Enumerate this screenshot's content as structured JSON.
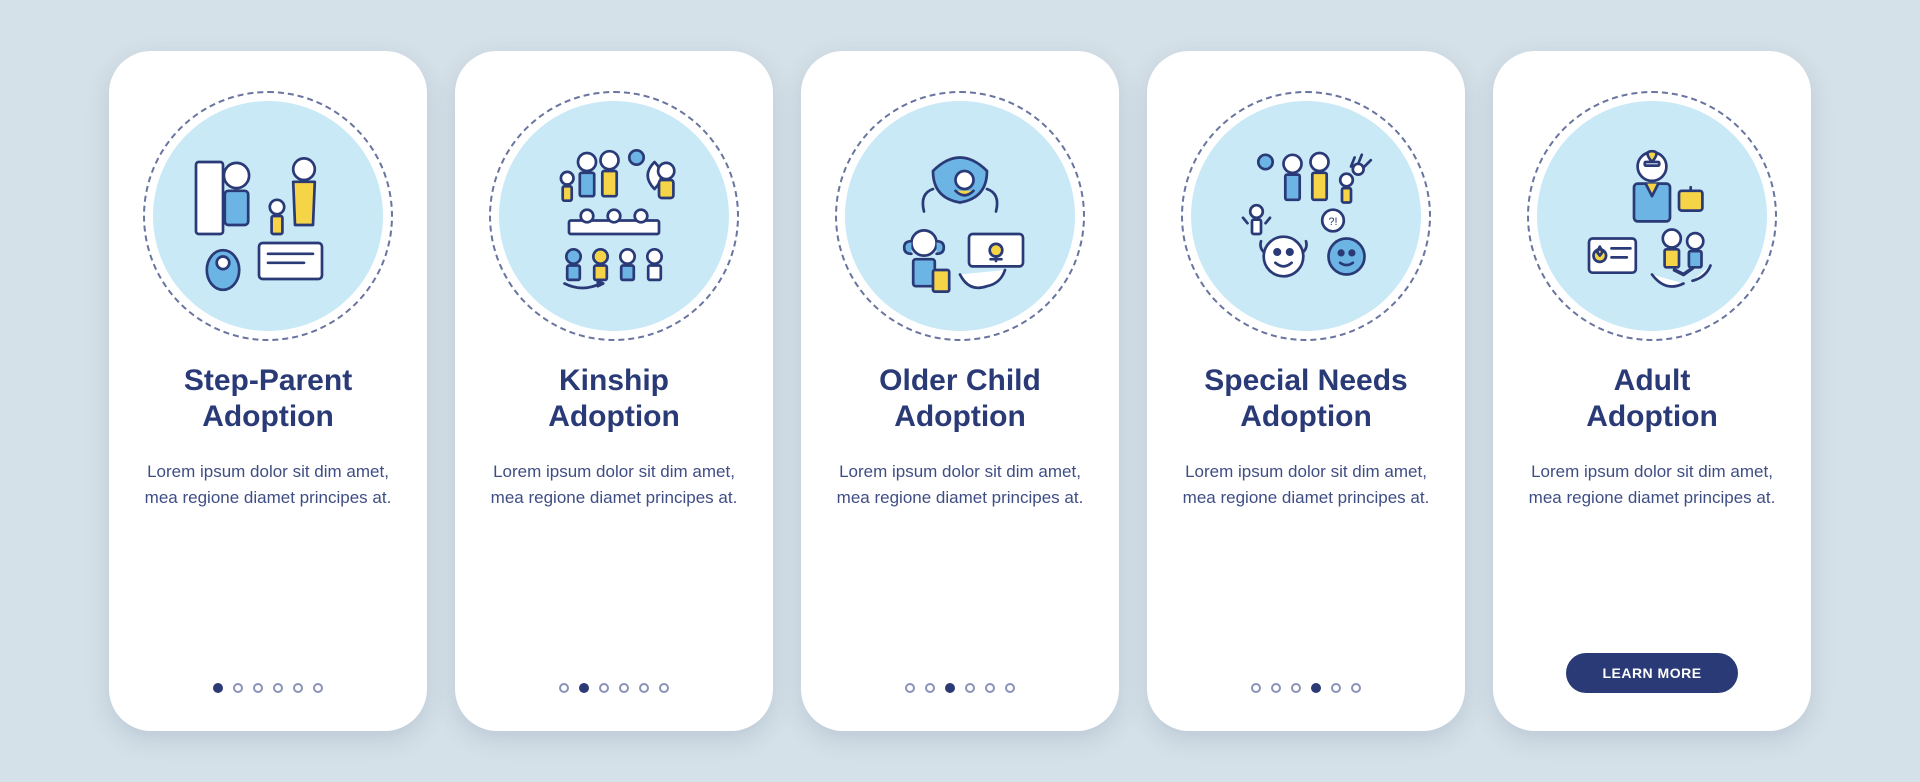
{
  "colors": {
    "background": "#d5e1e8",
    "card_bg": "#ffffff",
    "primary": "#2a3a77",
    "accent_light": "#c9e9f6",
    "accent_yellow": "#f5d547",
    "accent_blue": "#6cb4e4"
  },
  "total_pages": 6,
  "cards": [
    {
      "title": "Step-Parent\nAdoption",
      "description": "Lorem ipsum dolor sit dim amet, mea regione diamet principes at.",
      "active_dot": 0,
      "show_button": false,
      "icon_name": "step-parent-icon"
    },
    {
      "title": "Kinship\nAdoption",
      "description": "Lorem ipsum dolor sit dim amet, mea regione diamet principes at.",
      "active_dot": 1,
      "show_button": false,
      "icon_name": "kinship-icon"
    },
    {
      "title": "Older Child\nAdoption",
      "description": "Lorem ipsum dolor sit dim amet, mea regione diamet principes at.",
      "active_dot": 2,
      "show_button": false,
      "icon_name": "older-child-icon"
    },
    {
      "title": "Special Needs\nAdoption",
      "description": "Lorem ipsum dolor sit dim amet, mea regione diamet principes at.",
      "active_dot": 3,
      "show_button": false,
      "icon_name": "special-needs-icon"
    },
    {
      "title": "Adult\nAdoption",
      "description": "Lorem ipsum dolor sit dim amet, mea regione diamet principes at.",
      "active_dot": 4,
      "show_button": true,
      "icon_name": "adult-adoption-icon"
    }
  ],
  "button_label": "LEARN MORE"
}
